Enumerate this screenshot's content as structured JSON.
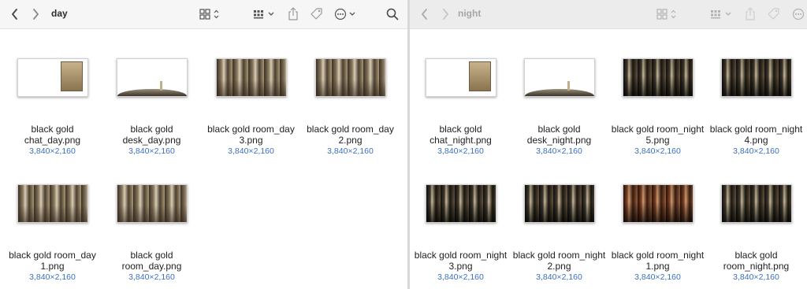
{
  "day_window": {
    "title": "day",
    "toolbar": {
      "back_icon": "chevron-left-icon",
      "forward_icon": "chevron-right-icon",
      "view_icon": "grid-icon",
      "group_icon": "group-grid-icon",
      "share_icon": "share-icon",
      "tag_icon": "tag-icon",
      "more_icon": "ellipsis-circle-icon",
      "search_icon": "search-icon"
    },
    "files": [
      {
        "name_line1": "black gold",
        "name_line2": "chat_day.png",
        "dims": "3,840×2,160"
      },
      {
        "name_line1": "black gold",
        "name_line2": "desk_day.png",
        "dims": "3,840×2,160"
      },
      {
        "name_line1": "black gold room_day",
        "name_line2": "3.png",
        "dims": "3,840×2,160"
      },
      {
        "name_line1": "black gold room_day",
        "name_line2": "2.png",
        "dims": "3,840×2,160"
      },
      {
        "name_line1": "black gold room_day",
        "name_line2": "1.png",
        "dims": "3,840×2,160"
      },
      {
        "name_line1": "black gold",
        "name_line2": "room_day.png",
        "dims": "3,840×2,160"
      }
    ]
  },
  "night_window": {
    "title": "night",
    "files": [
      {
        "name_line1": "black gold",
        "name_line2": "chat_night.png",
        "dims": "3,840×2,160"
      },
      {
        "name_line1": "black gold",
        "name_line2": "desk_night.png",
        "dims": "3,840×2,160"
      },
      {
        "name_line1": "black gold room_night",
        "name_line2": "5.png",
        "dims": "3,840×2,160"
      },
      {
        "name_line1": "black gold room_night",
        "name_line2": "4.png",
        "dims": "3,840×2,160"
      },
      {
        "name_line1": "black gold room_night",
        "name_line2": "3.png",
        "dims": "3,840×2,160"
      },
      {
        "name_line1": "black gold room_night",
        "name_line2": "2.png",
        "dims": "3,840×2,160"
      },
      {
        "name_line1": "black gold room_night",
        "name_line2": "1.png",
        "dims": "3,840×2,160"
      },
      {
        "name_line1": "black gold",
        "name_line2": "room_night.png",
        "dims": "3,840×2,160"
      }
    ]
  },
  "colors": {
    "link_blue": "#3a6fc4",
    "toolbar_day": "#f6f6f6",
    "toolbar_night": "#ececec"
  }
}
